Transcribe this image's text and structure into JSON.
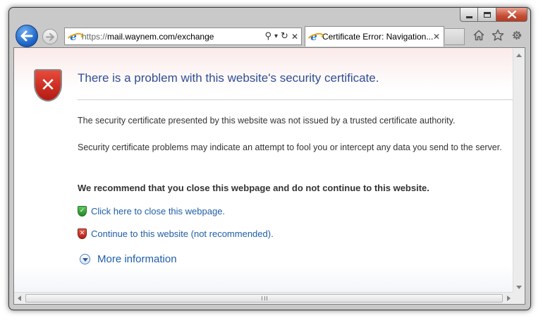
{
  "browser": {
    "address": {
      "scheme": "https://",
      "host": "mail.waynem.com/exchange"
    },
    "tab": {
      "title": "Certificate Error: Navigation...",
      "close_glyph": "✕"
    },
    "addr_tools": {
      "search_glyph": "⚲",
      "dropdown_glyph": "▾",
      "refresh_glyph": "↻",
      "stop_glyph": "✕"
    },
    "icons": {
      "back": "back-arrow-icon",
      "forward": "forward-arrow-icon",
      "home": "home-icon",
      "favorites": "star-icon",
      "tools": "gear-icon",
      "site": "ie-logo-icon"
    }
  },
  "page": {
    "heading": "There is a problem with this website's security certificate.",
    "paragraph1": "The security certificate presented by this website was not issued by a trusted certificate authority.",
    "paragraph2": "Security certificate problems may indicate an attempt to fool you or intercept any data you send to the server.",
    "recommendation": "We recommend that you close this webpage and do not continue to this website.",
    "close_link": "Click here to close this webpage.",
    "continue_link": "Continue to this website (not recommended).",
    "more_info": "More information"
  },
  "colors": {
    "heading": "#2f4f94",
    "link": "#1f5ea8",
    "shield_red": "#c8231a",
    "shield_green": "#2ca02c"
  }
}
